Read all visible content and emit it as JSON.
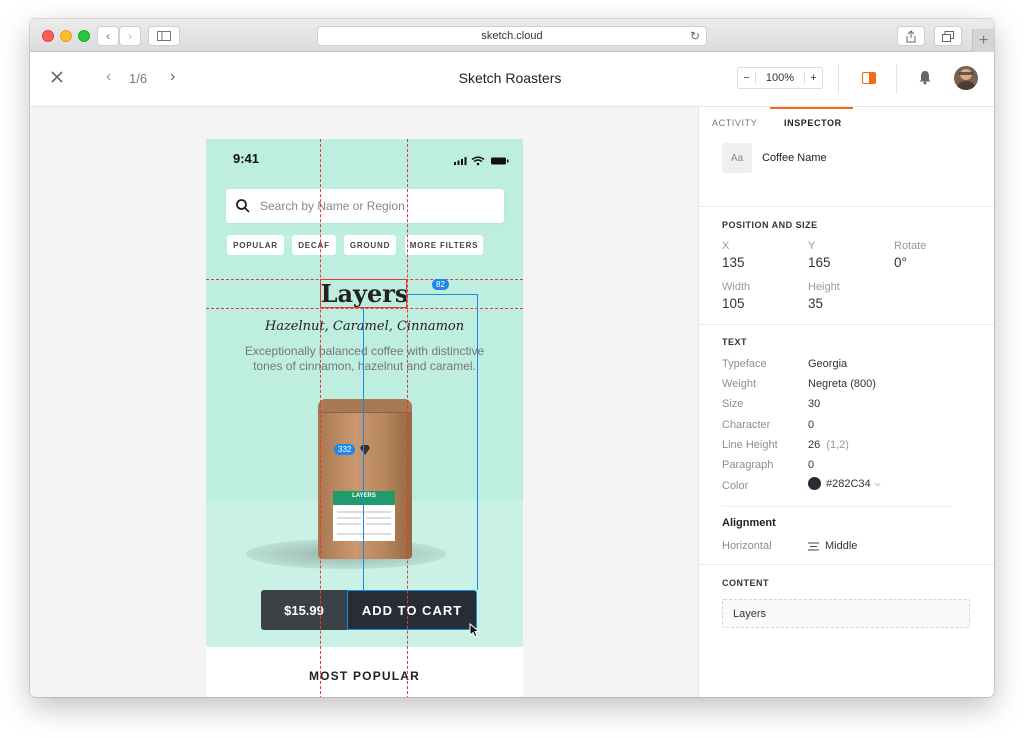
{
  "browser": {
    "url": "sketch.cloud"
  },
  "toolbar": {
    "page_counter": "1/6",
    "title": "Sketch Roasters",
    "zoom": "100%"
  },
  "phone": {
    "time": "9:41",
    "search_placeholder": "Search by Name or Region",
    "filters": [
      "POPULAR",
      "DECAF",
      "GROUND",
      "MORE FILTERS"
    ],
    "product_name": "Layers",
    "flavors": "Hazelnut, Caramel, Cinnamon",
    "description_line1": "Exceptionally balanced coffee with distinctive",
    "description_line2": "tones of cinnamon, hazelnut and caramel.",
    "bag_label": "LAYERS",
    "price": "$15.99",
    "cta": "ADD TO CART",
    "section_title": "MOST POPULAR"
  },
  "measure": {
    "top_badge": "82",
    "left_badge": "332"
  },
  "inspector": {
    "tabs": [
      "ACTIVITY",
      "INSPECTOR"
    ],
    "layer_icon_text": "Aa",
    "layer_name": "Coffee Name",
    "position_title": "POSITION AND SIZE",
    "x_label": "X",
    "x_value": "135",
    "y_label": "Y",
    "y_value": "165",
    "rotate_label": "Rotate",
    "rotate_value": "0°",
    "width_label": "Width",
    "width_value": "105",
    "height_label": "Height",
    "height_value": "35",
    "text_title": "TEXT",
    "typeface_label": "Typeface",
    "typeface_value": "Georgia",
    "weight_label": "Weight",
    "weight_value": "Negreta (800)",
    "size_label": "Size",
    "size_value": "30",
    "character_label": "Character",
    "character_value": "0",
    "lineheight_label": "Line Height",
    "lineheight_value": "26",
    "lineheight_extra": "(1,2)",
    "paragraph_label": "Paragraph",
    "paragraph_value": "0",
    "color_label": "Color",
    "color_value": "#282C34",
    "alignment_title": "Alignment",
    "horizontal_label": "Horizontal",
    "horizontal_value": "Middle",
    "content_title": "CONTENT",
    "content_value": "Layers"
  },
  "colors": {
    "accent": "#F26B1D",
    "mint": "#BDEEDF",
    "dark_button": "#282C34",
    "measure_blue": "#1E88E5",
    "guide_red": "#E53935"
  }
}
